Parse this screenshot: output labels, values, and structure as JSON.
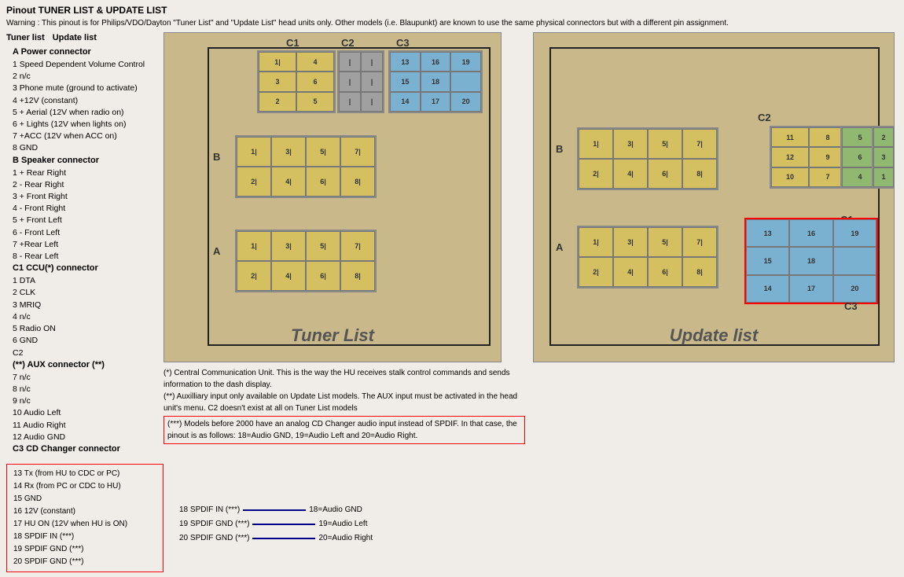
{
  "title": "Pinout TUNER LIST & UPDATE LIST",
  "warning": "Warning : This pinout is for Philips/VDO/Dayton \"Tuner List\" and \"Update List\" head units only. Other models (i.e. Blaupunkt) are known to use the same physical connectors but with a different pin assignment.",
  "left": {
    "tuner_list_label": "Tuner list",
    "update_list_label": "Update list",
    "section_a": "A Power connector",
    "items_a": [
      "1 Speed Dependent Volume Control",
      "2 n/c",
      "3 Phone mute (ground to activate)",
      "4 +12V (constant)",
      "5 + Aerial (12V when radio on)",
      "6 + Lights (12V when lights on)",
      "7 +ACC (12V when ACC on)",
      "8 GND"
    ],
    "section_b": "B Speaker connector",
    "items_b": [
      "1 + Rear Right",
      "2 - Rear Right",
      "3 + Front Right",
      "4 - Front Right",
      "5 + Front Left",
      "6 - Front Left",
      "7 +Rear Left",
      "8 - Rear Left"
    ],
    "section_c1": "C1 CCU(*) connector",
    "items_c1": [
      "1 DTA",
      "2 CLK",
      "3 MRIQ",
      "4 n/c",
      "5 Radio ON",
      "6 GND"
    ],
    "section_c2": "C2",
    "items_c2_header": "(**) AUX connector (**)",
    "items_c2": [
      "7 n/c",
      "8 n/c",
      "9 n/c",
      "10 Audio Left",
      "11 Audio Right",
      "12 Audio GND"
    ],
    "section_c3": "C3 CD Changer connector",
    "items_c3": [
      "13 Tx (from HU to CDC or PC)",
      "14 Rx (from PC or CDC to HU)",
      "15 GND",
      "16 12V (constant)",
      "17 HU ON (12V when HU is ON)",
      "18 SPDIF IN (***)",
      "19 SPDIF GND (***)",
      "20 SPDIF GND (***)"
    ]
  },
  "diagrams": {
    "tuner_list_label": "Tuner List",
    "update_list_label": "Update list",
    "c1_label": "C1",
    "c2_label": "C2",
    "c3_label": "C3",
    "b_label": "B",
    "a_label": "A"
  },
  "notes": {
    "note1": "(*) Central Communication Unit. This is the way the HU receives stalk control commands and sends information to the dash display.",
    "note2": "(**) Auxilliary input only available on Update List models. The AUX input must be activated in the head unit's menu. C2 doesn't exist at all on Tuner List models",
    "note3": "(***) Models before 2000 have an analog CD Changer audio input instead of SPDIF. In that case, the pinout is as follows: 18=Audio GND, 19=Audio Left and 20=Audio Right."
  },
  "wire_labels": {
    "w18": "18=Audio GND",
    "w19": "19=Audio Left",
    "w20": "20=Audio Right"
  },
  "bottom_list": [
    "13 Tx (from HU to CDC or PC)",
    "14 Rx (from PC or CDC to HU)",
    "15 GND",
    "16 12V (constant)",
    "17 HU ON (12V when HU is ON)",
    "18 SPDIF IN (***)",
    "19 SPDIF GND (***)",
    "20 SPDIF GND (***)"
  ]
}
